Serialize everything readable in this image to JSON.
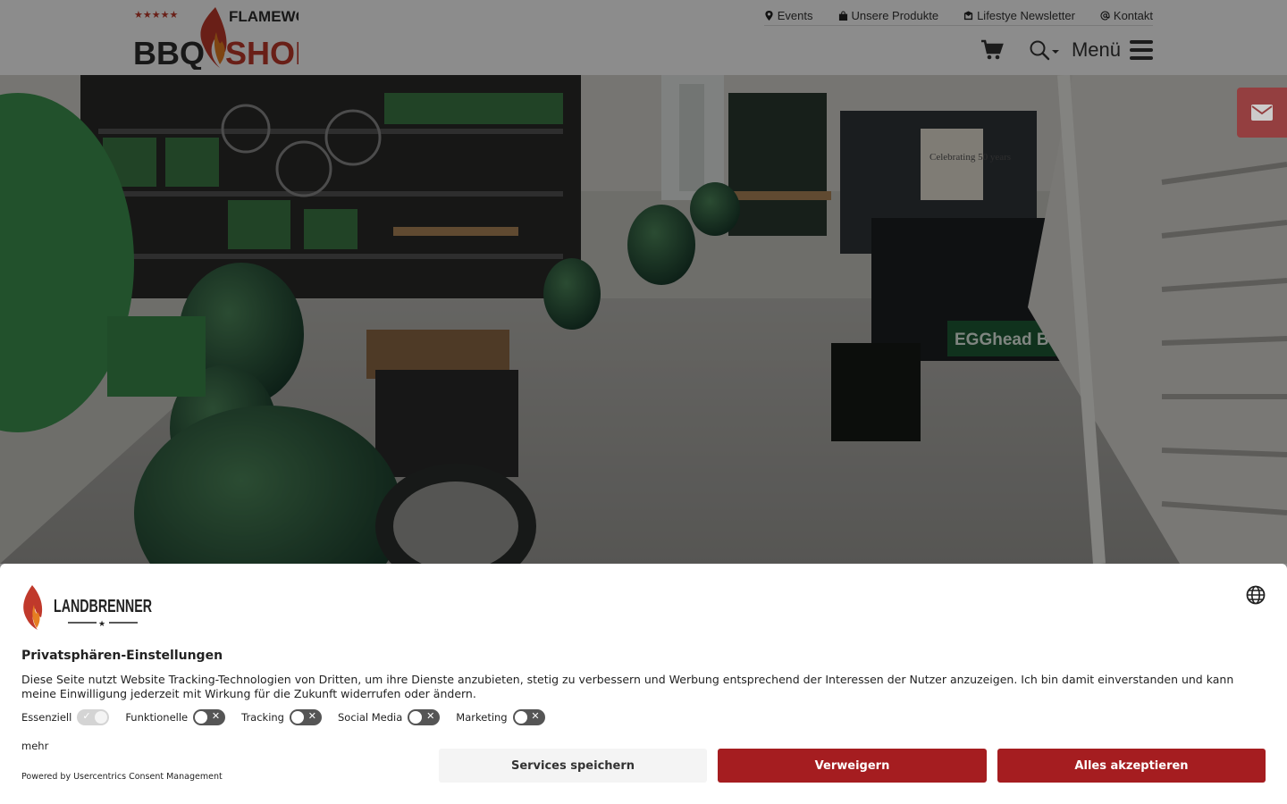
{
  "header": {
    "logo_small": "FLAMEWORK",
    "logo_left": "BBQ",
    "logo_right": "SHOP",
    "top_links": [
      {
        "label": "Events",
        "icon": "map-marker-icon"
      },
      {
        "label": "Unsere Produkte",
        "icon": "shopping-bag-icon"
      },
      {
        "label": "Lifestye Newsletter",
        "icon": "newsletter-icon"
      },
      {
        "label": "Kontakt",
        "icon": "at-sign-icon"
      }
    ],
    "menu_label": "Menü",
    "icons": {
      "cart": "shopping-cart-icon",
      "search": "search-icon",
      "menu": "hamburger-menu-icon"
    }
  },
  "hero": {
    "sign_text": "EGGhead Blvd",
    "banner_text": "Celebrating 50 years"
  },
  "side_button": {
    "icon": "envelope-icon"
  },
  "consent": {
    "brand": "LANDBRENNER",
    "title": "Privatsphären-Einstellungen",
    "text": "Diese Seite nutzt Website Tracking-Technologien von Dritten, um ihre Dienste anzubieten, stetig zu verbessern und Werbung entsprechend der Interessen der Nutzer anzuzeigen. Ich bin damit einverstanden und kann meine Einwilligung jederzeit mit Wirkung für die Zukunft widerrufen oder ändern.",
    "toggles": [
      {
        "label": "Essenziell",
        "on": true
      },
      {
        "label": "Funktionelle",
        "on": false
      },
      {
        "label": "Tracking",
        "on": false
      },
      {
        "label": "Social Media",
        "on": false
      },
      {
        "label": "Marketing",
        "on": false
      }
    ],
    "more_label": "mehr",
    "powered_by": "Powered by Usercentrics Consent Management",
    "buttons": {
      "save": "Services speichern",
      "deny": "Verweigern",
      "accept": "Alles akzeptieren"
    },
    "colors": {
      "accent": "#a51d20"
    }
  }
}
